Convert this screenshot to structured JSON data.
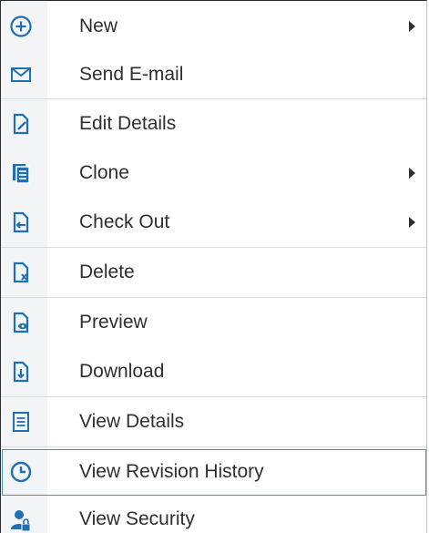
{
  "menu": {
    "items": [
      {
        "label": "New"
      },
      {
        "label": "Send E-mail"
      },
      {
        "label": "Edit Details"
      },
      {
        "label": "Clone"
      },
      {
        "label": "Check Out"
      },
      {
        "label": "Delete"
      },
      {
        "label": "Preview"
      },
      {
        "label": "Download"
      },
      {
        "label": "View Details"
      },
      {
        "label": "View Revision History"
      },
      {
        "label": "View Security"
      }
    ]
  },
  "colors": {
    "icon_blue": "#1f6fb3",
    "selected_border": "#4a90c8",
    "text": "#2f2f2f"
  }
}
